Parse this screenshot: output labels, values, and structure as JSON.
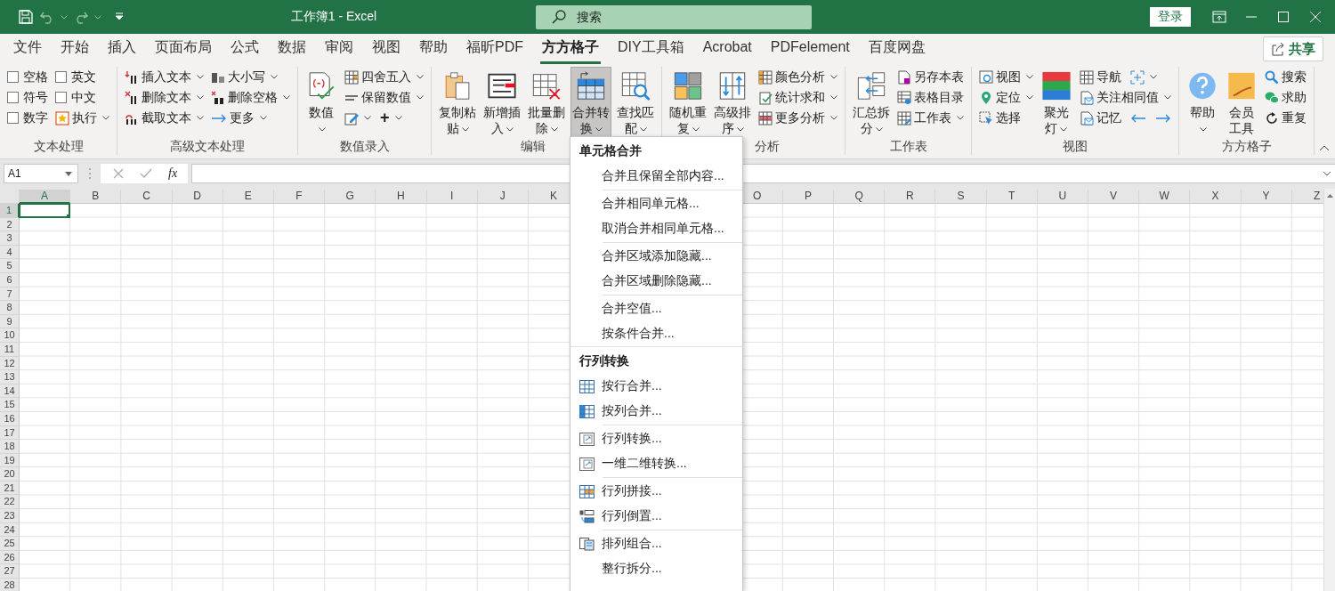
{
  "window": {
    "title": "工作簿1 - Excel",
    "search_placeholder": "搜索",
    "sign_in": "登录"
  },
  "menu_tabs": [
    {
      "label": "文件",
      "selected": false
    },
    {
      "label": "开始",
      "selected": false
    },
    {
      "label": "插入",
      "selected": false
    },
    {
      "label": "页面布局",
      "selected": false
    },
    {
      "label": "公式",
      "selected": false
    },
    {
      "label": "数据",
      "selected": false
    },
    {
      "label": "审阅",
      "selected": false
    },
    {
      "label": "视图",
      "selected": false
    },
    {
      "label": "帮助",
      "selected": false
    },
    {
      "label": "福昕PDF",
      "selected": false
    },
    {
      "label": "方方格子",
      "selected": true
    },
    {
      "label": "DIY工具箱",
      "selected": false
    },
    {
      "label": "Acrobat",
      "selected": false
    },
    {
      "label": "PDFelement",
      "selected": false
    },
    {
      "label": "百度网盘",
      "selected": false
    }
  ],
  "share": "共享",
  "ribbon": {
    "groups": [
      {
        "label": "文本处理",
        "columns": [
          [
            {
              "kind": "check",
              "label": "空格",
              "checked": false
            },
            {
              "kind": "check",
              "label": "符号",
              "checked": false
            },
            {
              "kind": "check",
              "label": "数字",
              "checked": false
            }
          ],
          [
            {
              "kind": "check",
              "label": "英文",
              "checked": false
            },
            {
              "kind": "check",
              "label": "中文",
              "checked": false
            },
            {
              "kind": "small",
              "label": "执行",
              "dropdown": true
            }
          ]
        ]
      },
      {
        "label": "高级文本处理",
        "columns": [
          [
            {
              "kind": "small",
              "label": "插入文本",
              "dropdown": true
            },
            {
              "kind": "small",
              "label": "删除文本",
              "dropdown": true
            },
            {
              "kind": "small",
              "label": "截取文本",
              "dropdown": true
            }
          ],
          [
            {
              "kind": "small",
              "label": "大小写",
              "dropdown": true
            },
            {
              "kind": "small",
              "label": "删除空格",
              "dropdown": true
            },
            {
              "kind": "small",
              "label": "更多",
              "dropdown": true
            }
          ]
        ]
      },
      {
        "label": "数值录入",
        "columns": [
          [
            {
              "kind": "large",
              "label": "数值",
              "dropdown": true,
              "expanded": false
            }
          ],
          [
            {
              "kind": "small",
              "label": "四舍五入",
              "dropdown": true
            },
            {
              "kind": "small",
              "label": "保留数值",
              "dropdown": true
            },
            {
              "kind": "row",
              "items": [
                {
                  "kind": "tool",
                  "dropdown": true
                },
                {
                  "kind": "tool",
                  "label": "+",
                  "dropdown": true
                }
              ]
            }
          ]
        ]
      },
      {
        "label": "编辑",
        "columns": [
          [
            {
              "kind": "large",
              "label": "复制粘贴",
              "dropdown": true,
              "expanded": false
            }
          ],
          [
            {
              "kind": "large",
              "label": "新增插入",
              "dropdown": true,
              "expanded": false
            }
          ],
          [
            {
              "kind": "large",
              "label": "批量删除",
              "dropdown": true,
              "expanded": false
            }
          ],
          [
            {
              "kind": "large",
              "label": "合并转换",
              "dropdown": true,
              "expanded": true
            }
          ],
          [
            {
              "kind": "large",
              "label": "查找匹配",
              "dropdown": true,
              "expanded": false
            }
          ]
        ]
      },
      {
        "label": "分析",
        "columns": [
          [
            {
              "kind": "large",
              "label": "随机重复",
              "dropdown": true,
              "expanded": false
            }
          ],
          [
            {
              "kind": "large",
              "label": "高级排序",
              "dropdown": true,
              "expanded": false
            }
          ],
          [
            {
              "kind": "small",
              "label": "颜色分析",
              "dropdown": true
            },
            {
              "kind": "small",
              "label": "统计求和",
              "dropdown": true
            },
            {
              "kind": "small",
              "label": "更多分析",
              "dropdown": true
            }
          ]
        ]
      },
      {
        "label": "工作表",
        "columns": [
          [
            {
              "kind": "large",
              "label": "汇总拆分",
              "dropdown": true,
              "expanded": false
            }
          ],
          [
            {
              "kind": "small",
              "label": "另存本表",
              "dropdown": false
            },
            {
              "kind": "small",
              "label": "表格目录",
              "dropdown": false
            },
            {
              "kind": "small",
              "label": "工作表",
              "dropdown": true
            }
          ]
        ]
      },
      {
        "label": "视图",
        "columns": [
          [
            {
              "kind": "small",
              "label": "视图",
              "dropdown": true
            },
            {
              "kind": "small",
              "label": "定位",
              "dropdown": true
            },
            {
              "kind": "small",
              "label": "选择",
              "dropdown": false
            }
          ],
          [
            {
              "kind": "large",
              "label": "聚光灯",
              "dropdown": true,
              "expanded": false
            }
          ],
          [
            {
              "kind": "row",
              "items": [
                {
                  "kind": "small",
                  "label": "导航",
                  "dropdown": false
                },
                {
                  "kind": "tool",
                  "dropdown": true
                }
              ]
            },
            {
              "kind": "small",
              "label": "关注相同值",
              "dropdown": true
            },
            {
              "kind": "row",
              "items": [
                {
                  "kind": "small",
                  "label": "记忆",
                  "dropdown": false
                },
                {
                  "kind": "tool",
                  "dropdown": false
                },
                {
                  "kind": "tool",
                  "dropdown": false
                }
              ]
            }
          ]
        ]
      },
      {
        "label": "方方格子",
        "columns": [
          [
            {
              "kind": "large",
              "label": "帮助",
              "dropdown": true,
              "expanded": false
            }
          ],
          [
            {
              "kind": "large",
              "label": "会员工具",
              "dropdown": false,
              "expanded": false
            }
          ],
          [
            {
              "kind": "small",
              "label": "搜索",
              "dropdown": false
            },
            {
              "kind": "small",
              "label": "求助",
              "dropdown": false
            },
            {
              "kind": "small",
              "label": "重复",
              "dropdown": false
            }
          ]
        ]
      }
    ]
  },
  "formula_bar": {
    "name_box": "A1",
    "function_label": "fx"
  },
  "dropdown_menu": {
    "sections": [
      {
        "title": "单元格合并",
        "items": [
          {
            "label": "合并且保留全部内容...",
            "kind": "plain",
            "divider_before": false
          },
          {
            "label": "合并相同单元格...",
            "kind": "plain",
            "divider_before": true
          },
          {
            "label": "取消合并相同单元格...",
            "kind": "plain",
            "divider_before": false
          },
          {
            "label": "合并区域添加隐藏...",
            "kind": "plain",
            "divider_before": true
          },
          {
            "label": "合并区域删除隐藏...",
            "kind": "plain",
            "divider_before": false
          },
          {
            "label": "合并空值...",
            "kind": "plain",
            "divider_before": true
          },
          {
            "label": "按条件合并...",
            "kind": "plain",
            "divider_before": false
          }
        ]
      },
      {
        "title": "行列转换",
        "items": [
          {
            "label": "按行合并...",
            "kind": "grid",
            "divider_before": false
          },
          {
            "label": "按列合并...",
            "kind": "gridblue",
            "divider_before": false
          },
          {
            "label": "行列转换...",
            "kind": "transpose",
            "divider_before": true
          },
          {
            "label": "一维二维转换...",
            "kind": "transpose",
            "divider_before": false
          },
          {
            "label": "行列拼接...",
            "kind": "splice",
            "divider_before": true
          },
          {
            "label": "行列倒置...",
            "kind": "invert",
            "divider_before": false
          },
          {
            "label": "排列组合...",
            "kind": "arrange",
            "divider_before": true
          },
          {
            "label": "整行拆分...",
            "kind": "plain",
            "divider_before": false
          }
        ]
      }
    ]
  },
  "sheet": {
    "columns_left": [
      {
        "label": "A",
        "selected": true
      },
      {
        "label": "B",
        "selected": false
      },
      {
        "label": "C",
        "selected": false
      },
      {
        "label": "D",
        "selected": false
      },
      {
        "label": "E",
        "selected": false
      },
      {
        "label": "F",
        "selected": false
      },
      {
        "label": "G",
        "selected": false
      },
      {
        "label": "H",
        "selected": false
      },
      {
        "label": "I",
        "selected": false
      },
      {
        "label": "J",
        "selected": false
      },
      {
        "label": "K",
        "selected": false
      }
    ],
    "columns_right": [
      {
        "label": "O",
        "selected": false
      },
      {
        "label": "P",
        "selected": false
      },
      {
        "label": "Q",
        "selected": false
      },
      {
        "label": "R",
        "selected": false
      },
      {
        "label": "S",
        "selected": false
      },
      {
        "label": "T",
        "selected": false
      },
      {
        "label": "U",
        "selected": false
      },
      {
        "label": "V",
        "selected": false
      },
      {
        "label": "W",
        "selected": false
      },
      {
        "label": "X",
        "selected": false
      },
      {
        "label": "Y",
        "selected": false
      },
      {
        "label": "Z",
        "selected": false
      }
    ],
    "rows": [
      {
        "label": "1",
        "selected": true
      },
      {
        "label": "2",
        "selected": false
      },
      {
        "label": "3",
        "selected": false
      },
      {
        "label": "4",
        "selected": false
      },
      {
        "label": "5",
        "selected": false
      },
      {
        "label": "6",
        "selected": false
      },
      {
        "label": "7",
        "selected": false
      },
      {
        "label": "8",
        "selected": false
      },
      {
        "label": "9",
        "selected": false
      },
      {
        "label": "10",
        "selected": false
      },
      {
        "label": "11",
        "selected": false
      },
      {
        "label": "12",
        "selected": false
      },
      {
        "label": "13",
        "selected": false
      },
      {
        "label": "14",
        "selected": false
      },
      {
        "label": "15",
        "selected": false
      },
      {
        "label": "16",
        "selected": false
      },
      {
        "label": "17",
        "selected": false
      },
      {
        "label": "18",
        "selected": false
      },
      {
        "label": "19",
        "selected": false
      },
      {
        "label": "20",
        "selected": false
      },
      {
        "label": "21",
        "selected": false
      },
      {
        "label": "22",
        "selected": false
      },
      {
        "label": "23",
        "selected": false
      },
      {
        "label": "24",
        "selected": false
      },
      {
        "label": "25",
        "selected": false
      },
      {
        "label": "26",
        "selected": false
      },
      {
        "label": "27",
        "selected": false
      },
      {
        "label": "28",
        "selected": false
      }
    ]
  }
}
